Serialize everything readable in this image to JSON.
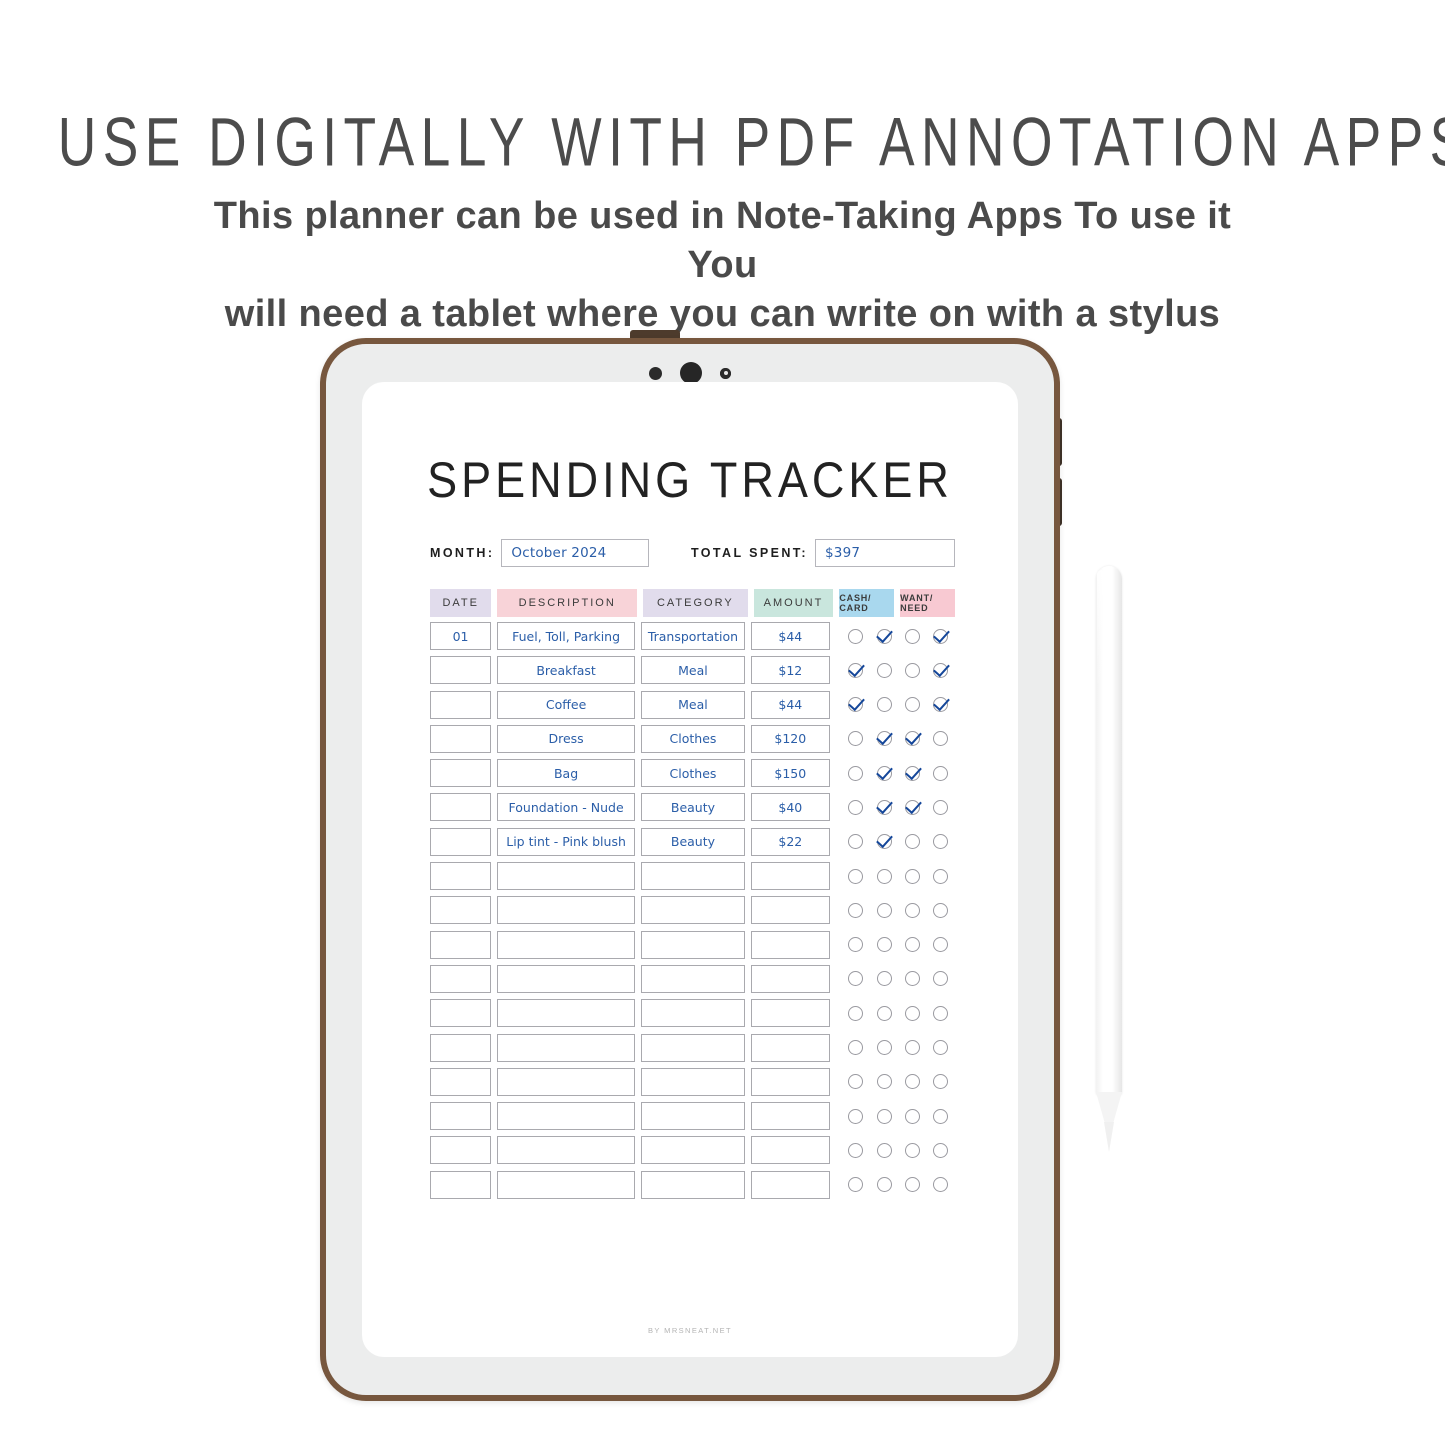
{
  "promo": {
    "headline": "USE DIGITALLY WITH PDF  ANNOTATION APPS",
    "sub_line1": "This planner can be used in Note-Taking Apps  To use it You",
    "sub_line2": "will need a tablet where you can write on with a stylus"
  },
  "planner": {
    "title": "SPENDING TRACKER",
    "month_label": "MONTH:",
    "month_value": "October 2024",
    "total_label": "TOTAL SPENT:",
    "total_value": "$397",
    "footer": "BY MRSNEAT.NET",
    "columns": {
      "date": "DATE",
      "description": "DESCRIPTION",
      "category": "CATEGORY",
      "amount": "AMOUNT",
      "cash_card": "CASH/ CARD",
      "want_need": "WANT/ NEED"
    },
    "colors": {
      "date_header": "#e1dcec",
      "description_header": "#f8d3d8",
      "category_header": "#e1dcec",
      "amount_header": "#c9e6dd",
      "cash_card_header": "#a9d8ee",
      "want_need_header": "#f8c9d2",
      "handwriting": "#2b5ea8",
      "check_mark": "#15479a",
      "tablet_frame": "#77573e",
      "tablet_bezel": "#eceded"
    },
    "rows": [
      {
        "date": "01",
        "description": "Fuel, Toll, Parking",
        "category": "Transportation",
        "amount": "$44",
        "checks": [
          false,
          true,
          false,
          true
        ]
      },
      {
        "date": "",
        "description": "Breakfast",
        "category": "Meal",
        "amount": "$12",
        "checks": [
          true,
          false,
          false,
          true
        ]
      },
      {
        "date": "",
        "description": "Coffee",
        "category": "Meal",
        "amount": "$44",
        "checks": [
          true,
          false,
          false,
          true
        ]
      },
      {
        "date": "",
        "description": "Dress",
        "category": "Clothes",
        "amount": "$120",
        "checks": [
          false,
          true,
          true,
          false
        ]
      },
      {
        "date": "",
        "description": "Bag",
        "category": "Clothes",
        "amount": "$150",
        "checks": [
          false,
          true,
          true,
          false
        ]
      },
      {
        "date": "",
        "description": "Foundation - Nude",
        "category": "Beauty",
        "amount": "$40",
        "checks": [
          false,
          true,
          true,
          false
        ]
      },
      {
        "date": "",
        "description": "Lip tint - Pink blush",
        "category": "Beauty",
        "amount": "$22",
        "checks": [
          false,
          true,
          false,
          false
        ]
      },
      {
        "date": "",
        "description": "",
        "category": "",
        "amount": "",
        "checks": [
          false,
          false,
          false,
          false
        ]
      },
      {
        "date": "",
        "description": "",
        "category": "",
        "amount": "",
        "checks": [
          false,
          false,
          false,
          false
        ]
      },
      {
        "date": "",
        "description": "",
        "category": "",
        "amount": "",
        "checks": [
          false,
          false,
          false,
          false
        ]
      },
      {
        "date": "",
        "description": "",
        "category": "",
        "amount": "",
        "checks": [
          false,
          false,
          false,
          false
        ]
      },
      {
        "date": "",
        "description": "",
        "category": "",
        "amount": "",
        "checks": [
          false,
          false,
          false,
          false
        ]
      },
      {
        "date": "",
        "description": "",
        "category": "",
        "amount": "",
        "checks": [
          false,
          false,
          false,
          false
        ]
      },
      {
        "date": "",
        "description": "",
        "category": "",
        "amount": "",
        "checks": [
          false,
          false,
          false,
          false
        ]
      },
      {
        "date": "",
        "description": "",
        "category": "",
        "amount": "",
        "checks": [
          false,
          false,
          false,
          false
        ]
      },
      {
        "date": "",
        "description": "",
        "category": "",
        "amount": "",
        "checks": [
          false,
          false,
          false,
          false
        ]
      },
      {
        "date": "",
        "description": "",
        "category": "",
        "amount": "",
        "checks": [
          false,
          false,
          false,
          false
        ]
      }
    ]
  },
  "device": {
    "sensors": [
      "ambient-light-sensor",
      "front-camera",
      "microphone"
    ],
    "buttons": [
      "power-button",
      "volume-up-button",
      "volume-down-button"
    ],
    "stylus": "apple-pencil"
  }
}
